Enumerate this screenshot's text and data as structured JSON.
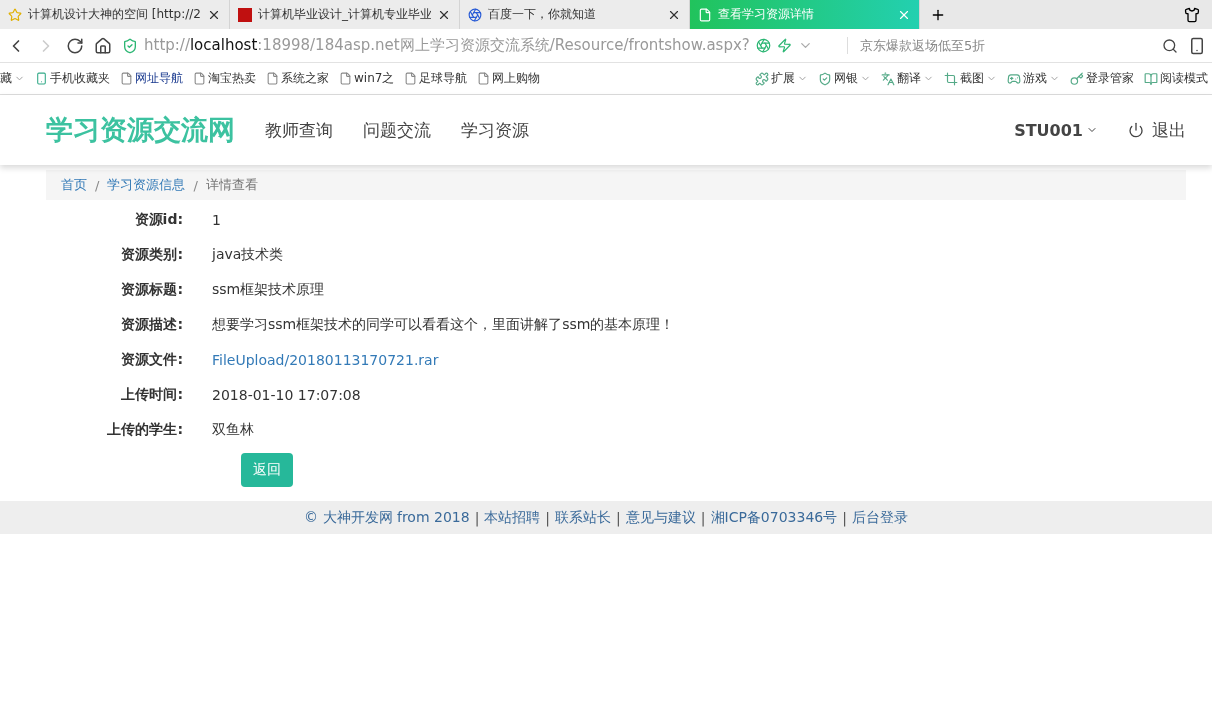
{
  "browser": {
    "tabs": [
      {
        "title": "计算机设计大神的空间 [http://2",
        "selected": false
      },
      {
        "title": "计算机毕业设计_计算机专业毕业",
        "selected": false
      },
      {
        "title": "百度一下，你就知道",
        "selected": false
      },
      {
        "title": "查看学习资源详情",
        "selected": true
      }
    ],
    "address": {
      "scheme": "http://",
      "host": "localhost",
      "rest": ":18998/184asp.net网上学习资源交流系统/Resource/frontshow.aspx?"
    },
    "search": {
      "placeholder": "京东爆款返场低至5折"
    },
    "bookmarks": [
      {
        "label": "藏",
        "kind": "menu"
      },
      {
        "label": "手机收藏夹",
        "kind": "phone"
      },
      {
        "label": "网址导航",
        "kind": "page"
      },
      {
        "label": "淘宝热卖",
        "kind": "page"
      },
      {
        "label": "系统之家",
        "kind": "page"
      },
      {
        "label": "win7之",
        "kind": "page"
      },
      {
        "label": "足球导航",
        "kind": "page"
      },
      {
        "label": "网上购物",
        "kind": "page"
      }
    ],
    "tools": [
      {
        "label": "扩展",
        "dropdown": true
      },
      {
        "label": "网银",
        "dropdown": true
      },
      {
        "label": "翻译",
        "dropdown": true
      },
      {
        "label": "截图",
        "dropdown": true
      },
      {
        "label": "游戏",
        "dropdown": true
      },
      {
        "label": "登录管家",
        "dropdown": false
      },
      {
        "label": "阅读模式",
        "dropdown": false
      }
    ]
  },
  "navbar": {
    "brand": "学习资源交流网",
    "links": [
      "教师查询",
      "问题交流",
      "学习资源"
    ],
    "user": "STU001",
    "logout": "退出"
  },
  "breadcrumb": [
    {
      "kind": "link",
      "text": "首页"
    },
    {
      "kind": "separator",
      "text": "/"
    },
    {
      "kind": "link",
      "text": "学习资源信息"
    },
    {
      "kind": "separator",
      "text": "/"
    },
    {
      "kind": "current",
      "text": "详情查看"
    }
  ],
  "details": [
    {
      "label": "资源id:",
      "value": "1",
      "kind": "text"
    },
    {
      "label": "资源类别:",
      "value": "java技术类",
      "kind": "text"
    },
    {
      "label": "资源标题:",
      "value": "ssm框架技术原理",
      "kind": "text"
    },
    {
      "label": "资源描述:",
      "value": "想要学习ssm框架技术的同学可以看看这个，里面讲解了ssm的基本原理！",
      "kind": "text"
    },
    {
      "label": "资源文件:",
      "value": "FileUpload/20180113170721.rar",
      "kind": "link"
    },
    {
      "label": "上传时间:",
      "value": "2018-01-10 17:07:08",
      "kind": "text"
    },
    {
      "label": "上传的学生:",
      "value": "双鱼林",
      "kind": "text"
    }
  ],
  "back_button": "返回",
  "footer": [
    {
      "kind": "text",
      "text": "© 大神开发网 from 2018"
    },
    {
      "kind": "separator",
      "text": "|"
    },
    {
      "kind": "link",
      "text": "本站招聘"
    },
    {
      "kind": "separator",
      "text": "|"
    },
    {
      "kind": "link",
      "text": "联系站长"
    },
    {
      "kind": "separator",
      "text": "|"
    },
    {
      "kind": "link",
      "text": "意见与建议"
    },
    {
      "kind": "separator",
      "text": "|"
    },
    {
      "kind": "link",
      "text": "湘ICP备0703346号"
    },
    {
      "kind": "separator",
      "text": "|"
    },
    {
      "kind": "link",
      "text": "后台登录"
    }
  ]
}
